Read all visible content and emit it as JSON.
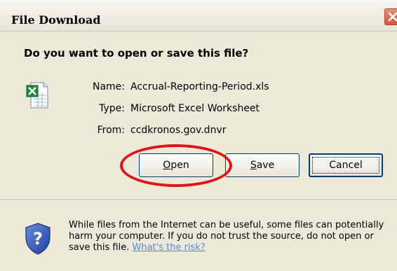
{
  "window": {
    "title": "File Download"
  },
  "prompt": {
    "question": "Do you want to open or save this file?"
  },
  "file": {
    "icon": "excel-file-icon",
    "rows": [
      {
        "label": "Name:",
        "value": "Accrual-Reporting-Period.xls"
      },
      {
        "label": "Type:",
        "value": "Microsoft Excel Worksheet"
      },
      {
        "label": "From:",
        "value": "ccdkronos.gov.dnvr"
      }
    ]
  },
  "buttons": {
    "open": {
      "accel": "O",
      "rest": "pen"
    },
    "save": {
      "accel": "S",
      "rest": "ave"
    },
    "cancel": {
      "label": "Cancel"
    }
  },
  "warning": {
    "icon": "shield-question-icon",
    "text": "While files from the Internet can be useful, some files can potentially harm your computer. If you do not trust the source, do not open or save this file.",
    "link": "What's the risk?"
  },
  "colors": {
    "highlight_ring": "#e01418",
    "link": "#5b86d6",
    "dialog_bg": "#ece9d8"
  }
}
